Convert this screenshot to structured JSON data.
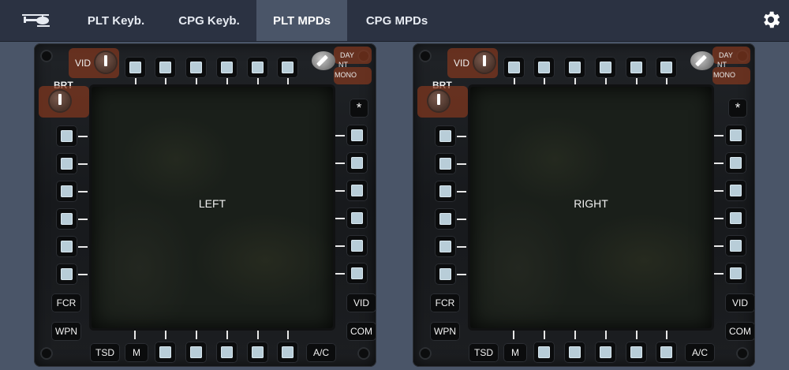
{
  "nav": {
    "tabs": [
      {
        "label": "PLT Keyb.",
        "active": false
      },
      {
        "label": "CPG Keyb.",
        "active": false
      },
      {
        "label": "PLT MPDs",
        "active": true
      },
      {
        "label": "CPG MPDs",
        "active": false
      }
    ],
    "logo_icon": "helicopter-icon",
    "settings_icon": "gear-icon"
  },
  "colors": {
    "nav_bg": "#2b3242",
    "page_bg": "#4a5568",
    "knob_highlight": "#82371e",
    "button_face": "#b8cdd8"
  },
  "mpds": [
    {
      "screen_label": "LEFT",
      "vid_label": "VID",
      "brt_label": "BRT",
      "mode_labels": [
        "DAY",
        "NT",
        "MONO"
      ],
      "asterisk": "*",
      "left_labels": [
        "FCR",
        "WPN"
      ],
      "right_labels": [
        "VID",
        "COM"
      ],
      "bottom_labels": [
        "TSD",
        "M",
        "A/C"
      ]
    },
    {
      "screen_label": "RIGHT",
      "vid_label": "VID",
      "brt_label": "BRT",
      "mode_labels": [
        "DAY",
        "NT",
        "MONO"
      ],
      "asterisk": "*",
      "left_labels": [
        "FCR",
        "WPN"
      ],
      "right_labels": [
        "VID",
        "COM"
      ],
      "bottom_labels": [
        "TSD",
        "M",
        "A/C"
      ]
    }
  ]
}
